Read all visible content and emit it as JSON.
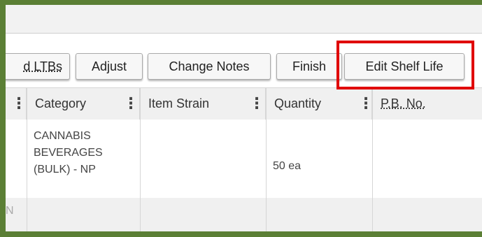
{
  "toolbar": {
    "buttons": [
      {
        "label": "d LTBs"
      },
      {
        "label": "Adjust"
      },
      {
        "label": "Change Notes"
      },
      {
        "label": "Finish"
      },
      {
        "label": "Edit Shelf Life"
      }
    ]
  },
  "table": {
    "columns": [
      {
        "label": "Category"
      },
      {
        "label": "Item Strain"
      },
      {
        "label": "Quantity"
      },
      {
        "label": "P.B. No."
      }
    ],
    "kebab_glyph": "⋮",
    "rows": [
      {
        "category": "CANNABIS BEVERAGES (BULK) - NP",
        "item_strain": "",
        "quantity": "50 ea",
        "pb_no": ""
      },
      {
        "fragment": "N"
      }
    ]
  },
  "colors": {
    "frame_border": "#5b7f35",
    "highlight": "#e00000"
  }
}
